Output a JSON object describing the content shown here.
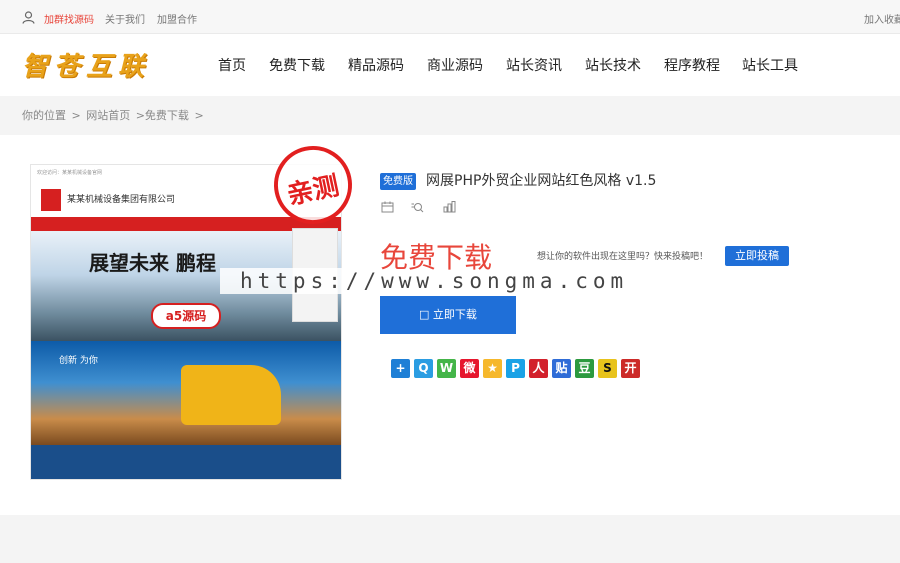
{
  "topbar": {
    "links": [
      "加群找源码",
      "关于我们",
      "加盟合作"
    ],
    "right_link": "加入收藏"
  },
  "header": {
    "logo_text": "智苍互联",
    "nav": [
      "首页",
      "免费下载",
      "精品源码",
      "商业源码",
      "站长资讯",
      "站长技术",
      "程序教程",
      "站长工具"
    ]
  },
  "breadcrumb": {
    "items": [
      "你的位置",
      ">",
      "网站首页",
      ">免费下载",
      ">"
    ]
  },
  "preview": {
    "top_text": "欢迎访问：某某机械设备官网",
    "company_name": "某某机械设备集团有限公司",
    "hero_text": "展望未来 鹏程",
    "watermark_logo": "a5源码",
    "slogan": "创新 为你",
    "stamp_text": "亲测"
  },
  "watermark": "https://www.songma.com",
  "product": {
    "badge": "免费版",
    "title": "网展PHP外贸企业网站红色风格 v1.5",
    "meta_icons": [
      "calendar-icon",
      "view-icon",
      "chart-icon"
    ]
  },
  "download": {
    "heading": "免费下载",
    "promo_text": "想让你的软件出现在这里吗？快来投稿吧！",
    "submit_label": "立即投稿",
    "download_label": "□ 立即下载"
  },
  "share": {
    "icons": [
      {
        "name": "plus",
        "glyph": "+",
        "color": "#1e7fd6"
      },
      {
        "name": "qq",
        "glyph": "Q",
        "color": "#2b9de2"
      },
      {
        "name": "wechat",
        "glyph": "W",
        "color": "#44b549"
      },
      {
        "name": "weibo",
        "glyph": "微",
        "color": "#e6162d"
      },
      {
        "name": "qzone",
        "glyph": "★",
        "color": "#f6b82c"
      },
      {
        "name": "pengyou",
        "glyph": "P",
        "color": "#1aa2e6"
      },
      {
        "name": "renren",
        "glyph": "人",
        "color": "#d2202b"
      },
      {
        "name": "tieba",
        "glyph": "贴",
        "color": "#2f6cd7"
      },
      {
        "name": "douban",
        "glyph": "豆",
        "color": "#2c9a3f"
      },
      {
        "name": "sohu",
        "glyph": "S",
        "color": "#e8c31c"
      },
      {
        "name": "kaixin",
        "glyph": "开",
        "color": "#cc2a28"
      }
    ]
  }
}
